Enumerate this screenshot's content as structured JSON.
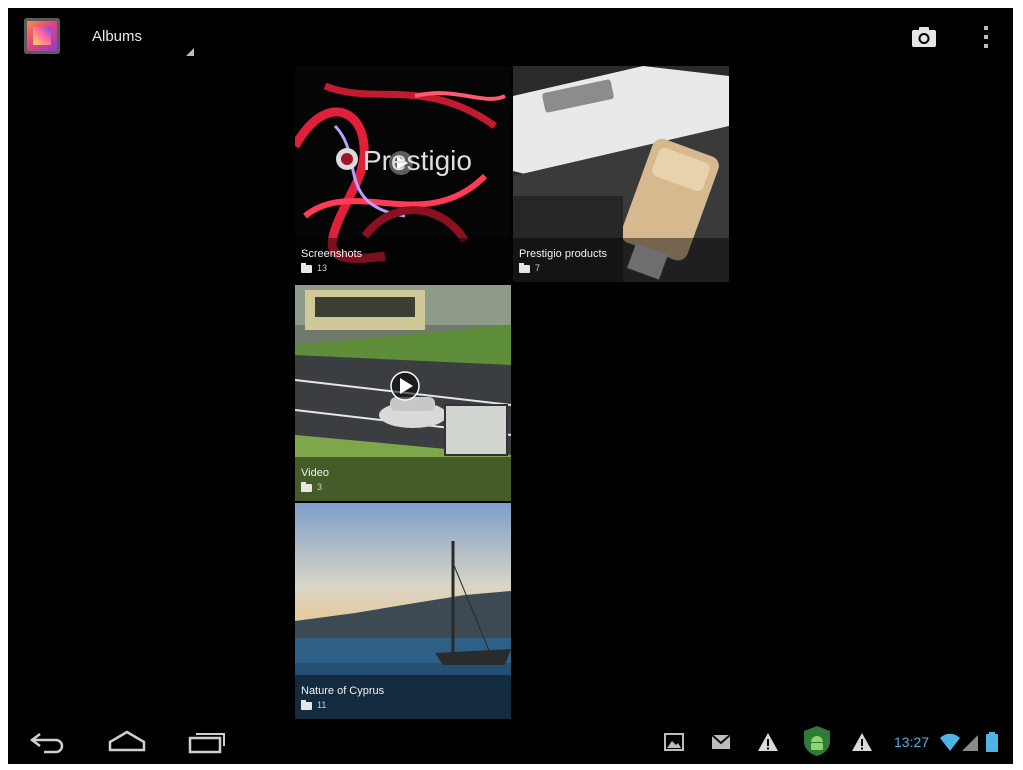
{
  "action_bar": {
    "title": "Albums",
    "icons": [
      "gallery-app-icon",
      "camera-icon",
      "overflow-menu-icon"
    ]
  },
  "albums": [
    {
      "name": "Screenshots",
      "count": "13",
      "thumb_text": "Prestigio"
    },
    {
      "name": "Prestigio products",
      "count": "7"
    },
    {
      "name": "Video",
      "count": "3"
    },
    {
      "name": "Nature of Cyprus",
      "count": "11"
    }
  ],
  "nav_bar": {
    "buttons": [
      "back-icon",
      "home-icon",
      "recent-apps-icon"
    ]
  },
  "status_bar": {
    "time": "13:27",
    "accent_color": "#4fb3e3",
    "notifications": [
      "gallery-notification-icon",
      "email-notification-icon",
      "warning-icon",
      "android-shield-icon",
      "warning-icon"
    ]
  }
}
